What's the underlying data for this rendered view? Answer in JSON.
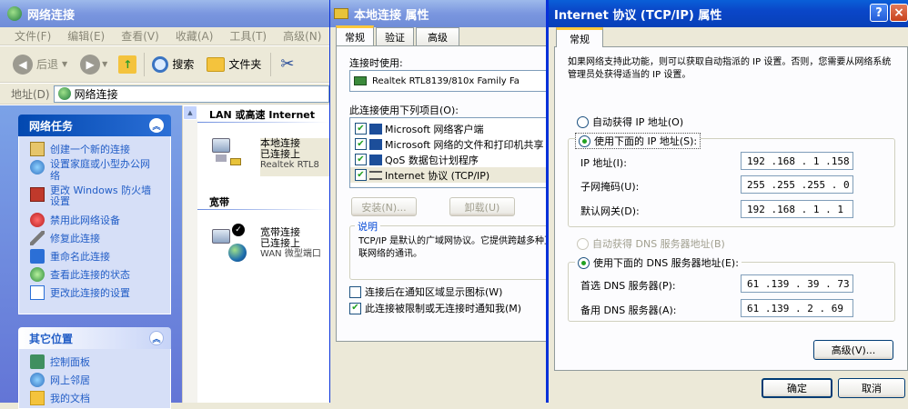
{
  "explorer": {
    "title": "网络连接",
    "menu": [
      "文件(F)",
      "编辑(E)",
      "查看(V)",
      "收藏(A)",
      "工具(T)",
      "高级(N)"
    ],
    "toolbar": {
      "back": "后退",
      "search": "搜索",
      "folders": "文件夹"
    },
    "address_label": "地址(D)",
    "address_value": "网络连接",
    "network_tasks": {
      "title": "网络任务",
      "items": [
        "创建一个新的连接",
        "设置家庭或小型办公网络",
        "更改 Windows 防火墙设置",
        "禁用此网络设备",
        "修复此连接",
        "重命名此连接",
        "查看此连接的状态",
        "更改此连接的设置"
      ]
    },
    "other_places": {
      "title": "其它位置",
      "items": [
        "控制面板",
        "网上邻居",
        "我的文档"
      ]
    },
    "groups": {
      "lan": "LAN 或高速 Internet",
      "broadband": "宽带"
    },
    "connections": [
      {
        "name": "本地连接",
        "status": "已连接上",
        "device": "Realtek RTL8"
      },
      {
        "name": "宽带连接",
        "status": "已连接上",
        "device": "WAN 微型端口"
      }
    ]
  },
  "local_props": {
    "title": "本地连接 属性",
    "tabs": [
      "常规",
      "验证",
      "高级"
    ],
    "connect_using_label": "连接时使用:",
    "adapter": "Realtek RTL8139/810x Family Fa",
    "items_label": "此连接使用下列项目(O):",
    "items": [
      {
        "label": "Microsoft 网络客户端",
        "checked": true
      },
      {
        "label": "Microsoft 网络的文件和打印机共享",
        "checked": true
      },
      {
        "label": "QoS 数据包计划程序",
        "checked": true
      },
      {
        "label": "Internet 协议 (TCP/IP)",
        "checked": true
      }
    ],
    "install": "安装(N)...",
    "uninstall": "卸载(U)",
    "desc_group": "说明",
    "desc_text": "TCP/IP 是默认的广域网协议。它提供跨越多种互联网络的通讯。",
    "show_icon": {
      "label": "连接后在通知区域显示图标(W)",
      "checked": false
    },
    "notify": {
      "label": "此连接被限制或无连接时通知我(M)",
      "checked": true
    }
  },
  "tcpip": {
    "title": "Internet 协议 (TCP/IP) 属性",
    "tab": "常规",
    "intro": "如果网络支持此功能，则可以获取自动指派的 IP 设置。否则，您需要从网络系统管理员处获得适当的 IP 设置。",
    "auto_ip": "自动获得 IP 地址(O)",
    "manual_ip": "使用下面的 IP 地址(S):",
    "ip_label": "IP 地址(I):",
    "ip_value": "192 .168 . 1  .158",
    "mask_label": "子网掩码(U):",
    "mask_value": "255 .255 .255 . 0",
    "gateway_label": "默认网关(D):",
    "gateway_value": "192 .168 . 1  . 1",
    "auto_dns": "自动获得 DNS 服务器地址(B)",
    "manual_dns": "使用下面的 DNS 服务器地址(E):",
    "dns1_label": "首选 DNS 服务器(P):",
    "dns1_value": "61  .139 . 39  . 73",
    "dns2_label": "备用 DNS 服务器(A):",
    "dns2_value": "61  .139 . 2  . 69",
    "advanced": "高级(V)...",
    "ok": "确定",
    "cancel": "取消",
    "help_btn": "?",
    "close_btn": "×"
  }
}
